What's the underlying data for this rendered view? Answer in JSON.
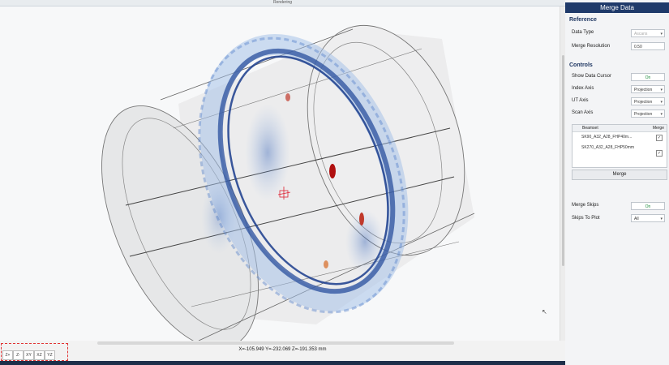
{
  "window": {
    "title": "Rendering"
  },
  "viewport": {
    "coords": "X=-105.949 Y=-232.069 Z=-191.353  mm",
    "view_buttons": [
      "Z+",
      "Z-",
      "XY",
      "XZ",
      "YZ"
    ]
  },
  "panel": {
    "title": "Merge Data",
    "reference": {
      "title": "Reference",
      "data_type_label": "Data Type",
      "data_type_value": "Ascans",
      "merge_resolution_label": "Merge Resolution",
      "merge_resolution_value": "0.50"
    },
    "controls": {
      "title": "Controls",
      "show_cursor_label": "Show Data Cursor",
      "show_cursor_value": "On",
      "index_axis_label": "Index Axis",
      "index_axis_value": "Projection",
      "ut_axis_label": "UT Axis",
      "ut_axis_value": "Projection",
      "scan_axis_label": "Scan Axis",
      "scan_axis_value": "Projection"
    },
    "beamset_table": {
      "headers": [
        "Beamset",
        "Merge"
      ],
      "rows": [
        "SK90_A32_A28_FHP40m...",
        "SK270_A32_A28_FHP50mm"
      ]
    },
    "merge_button": "Merge",
    "merge_skips_label": "Merge Skips",
    "merge_skips_value": "On",
    "skips_to_plot_label": "Skips To Plot",
    "skips_to_plot_value": "All"
  },
  "colors": {
    "panel_header": "#1f3a6a",
    "toggle_on": "#1b8a3a",
    "data_dense": "#1a3c8c",
    "data_peak": "#b01010"
  }
}
